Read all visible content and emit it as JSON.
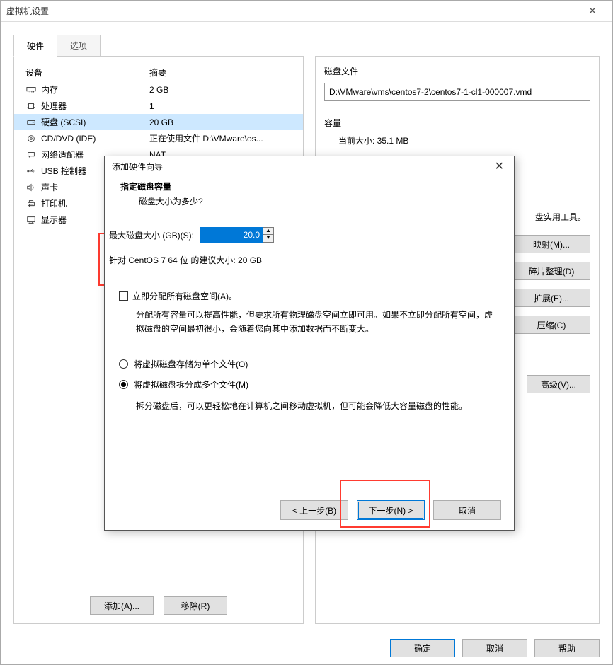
{
  "main": {
    "title": "虚拟机设置",
    "tabs": {
      "hardware": "硬件",
      "options": "选项"
    },
    "table": {
      "head_device": "设备",
      "head_summary": "摘要",
      "rows": [
        {
          "icon": "mem",
          "name": "内存",
          "summary": "2 GB"
        },
        {
          "icon": "cpu",
          "name": "处理器",
          "summary": "1"
        },
        {
          "icon": "disk",
          "name": "硬盘 (SCSI)",
          "summary": "20 GB",
          "selected": true
        },
        {
          "icon": "cd",
          "name": "CD/DVD (IDE)",
          "summary": "正在使用文件 D:\\VMware\\os..."
        },
        {
          "icon": "net",
          "name": "网络适配器",
          "summary": "NAT"
        },
        {
          "icon": "usb",
          "name": "USB 控制器",
          "summary": ""
        },
        {
          "icon": "snd",
          "name": "声卡",
          "summary": ""
        },
        {
          "icon": "prn",
          "name": "打印机",
          "summary": ""
        },
        {
          "icon": "disp",
          "name": "显示器",
          "summary": ""
        }
      ]
    },
    "add_btn": "添加(A)...",
    "remove_btn": "移除(R)"
  },
  "right": {
    "diskfile_label": "磁盘文件",
    "diskfile_value": "D:\\VMware\\vms\\centos7-2\\centos7-1-cl1-000007.vmd",
    "capacity_label": "容量",
    "current_size": "当前大小: 35.1 MB",
    "partial_label": "盘实用工具。",
    "btn_map": "映射(M)...",
    "btn_defrag": "碎片整理(D)",
    "btn_expand": "扩展(E)...",
    "btn_compact": "压缩(C)",
    "btn_advanced": "高级(V)..."
  },
  "bottom": {
    "ok": "确定",
    "cancel": "取消",
    "help": "帮助"
  },
  "wizard": {
    "title": "添加硬件向导",
    "head_title": "指定磁盘容量",
    "head_sub": "磁盘大小为多少?",
    "size_label": "最大磁盘大小 (GB)(S):",
    "size_value": "20.0",
    "recommend": "针对 CentOS 7 64 位 的建议大小: 20 GB",
    "alloc_now": "立即分配所有磁盘空间(A)。",
    "alloc_desc": "分配所有容量可以提高性能，但要求所有物理磁盘空间立即可用。如果不立即分配所有空间，虚拟磁盘的空间最初很小，会随着您向其中添加数据而不断变大。",
    "radio_single": "将虚拟磁盘存储为单个文件(O)",
    "radio_split": "将虚拟磁盘拆分成多个文件(M)",
    "split_desc": "拆分磁盘后，可以更轻松地在计算机之间移动虚拟机，但可能会降低大容量磁盘的性能。",
    "back": "< 上一步(B)",
    "next": "下一步(N) >",
    "cancel": "取消"
  }
}
